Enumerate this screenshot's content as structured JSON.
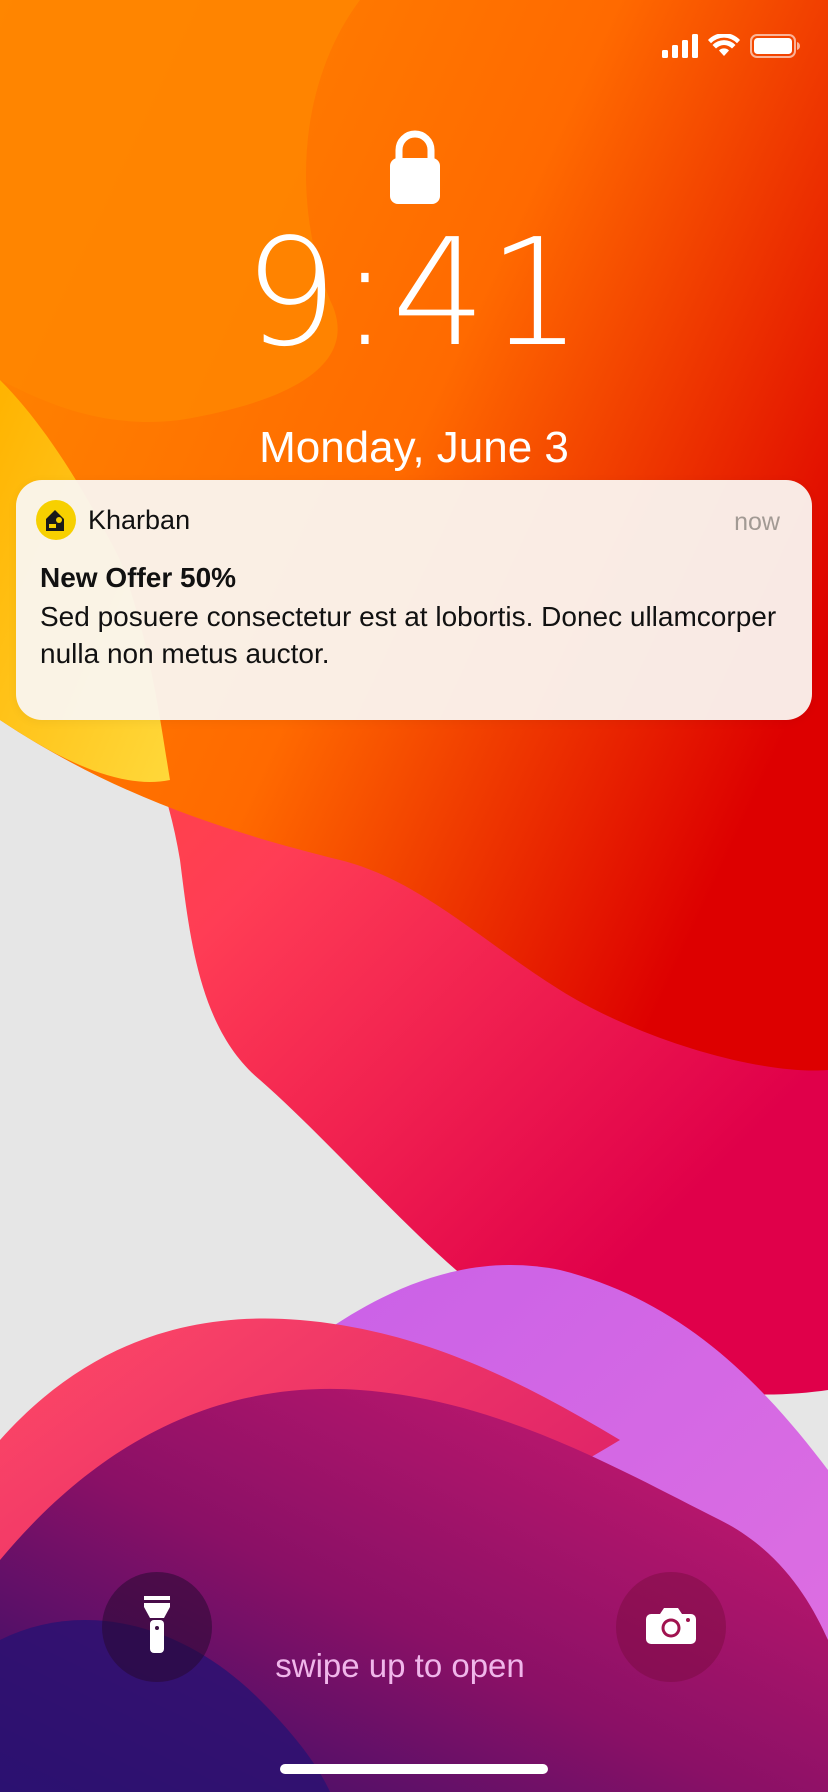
{
  "status_bar": {
    "signal_icon": "cellular-signal-icon",
    "wifi_icon": "wifi-icon",
    "battery_icon": "battery-icon"
  },
  "lock_screen": {
    "lock_icon": "lock-icon",
    "time": "9:41",
    "date": "Monday, June 3"
  },
  "notification": {
    "app_icon": "kharban-app-icon",
    "app_name": "Kharban",
    "time": "now",
    "title": "New Offer 50%",
    "body": "Sed posuere consectetur est at lobortis. Donec ullamcorper nulla non metus auctor."
  },
  "bottom": {
    "flashlight_icon": "flashlight-icon",
    "camera_icon": "camera-icon",
    "swipe_hint": "swipe up to open"
  },
  "colors": {
    "brand_yellow": "#f7d000",
    "notification_bg": "#faf5f0",
    "swipe_hint": "#f0b6ea"
  }
}
